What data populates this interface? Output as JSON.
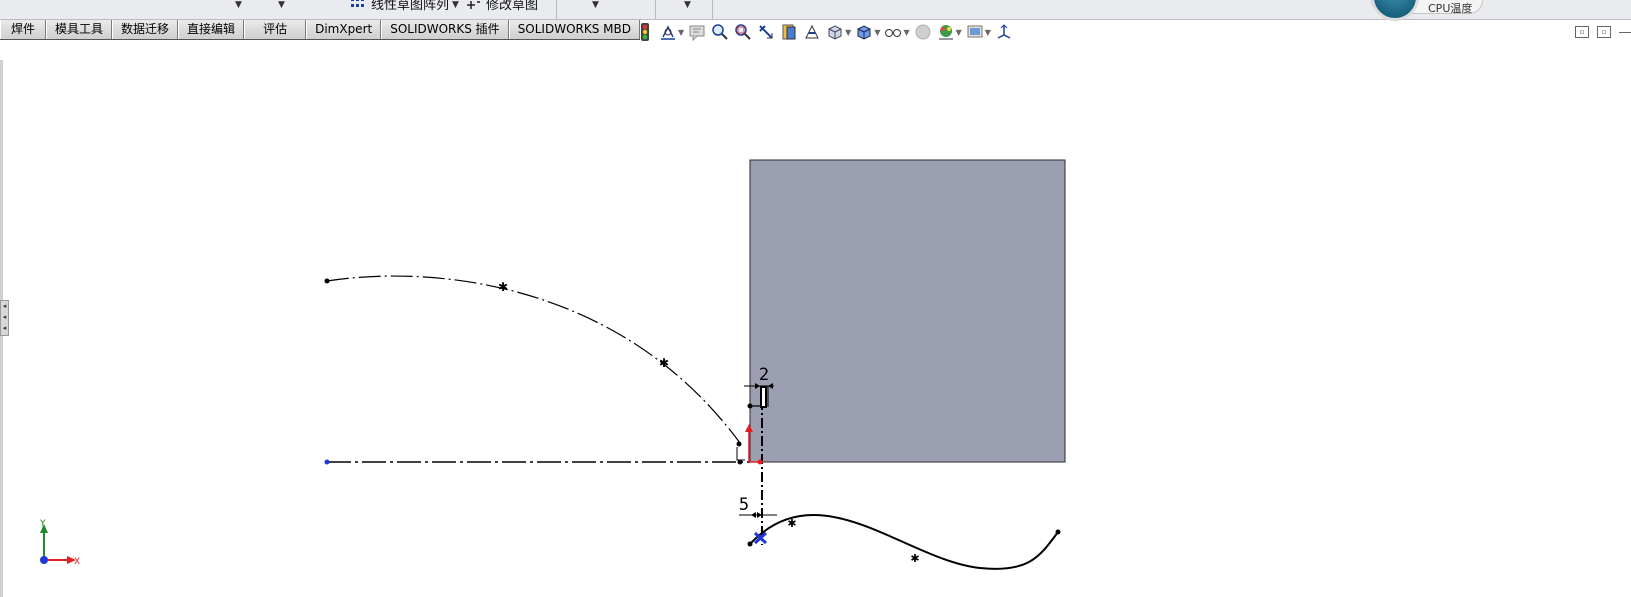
{
  "window": {
    "command_linear_pattern": "线性草图阵列",
    "command_modify_sketch": "修改草图",
    "cpu_widget_label": "CPU温度"
  },
  "tabs": [
    {
      "label": "焊件"
    },
    {
      "label": "模具工具"
    },
    {
      "label": "数据迁移"
    },
    {
      "label": "直接编辑"
    },
    {
      "label": "评估"
    },
    {
      "label": "DimXpert"
    },
    {
      "label": "SOLIDWORKS 插件"
    },
    {
      "label": "SOLIDWORKS MBD"
    }
  ],
  "view_toolbar_icons": [
    "traffic-light-icon",
    "sketch-display-icon",
    "note-icon",
    "zoom-to-fit-icon",
    "zoom-area-icon",
    "previous-view-icon",
    "section-view-icon",
    "dynamic-annotation-icon",
    "view-orientation-icon",
    "display-style-icon",
    "hide-show-icon",
    "edit-appearance-icon",
    "apply-scene-icon",
    "view-settings-icon",
    "coordinate-triad-icon"
  ],
  "sketch": {
    "dimension_top": "2",
    "dimension_bottom": "5",
    "triad_x_label": "X",
    "triad_y_label": "Y"
  },
  "colors": {
    "part_face": "#9b9fb1",
    "origin_red": "#e21f1f",
    "selected_blue": "#1f36e0",
    "triad_green": "#1f8a2a"
  }
}
